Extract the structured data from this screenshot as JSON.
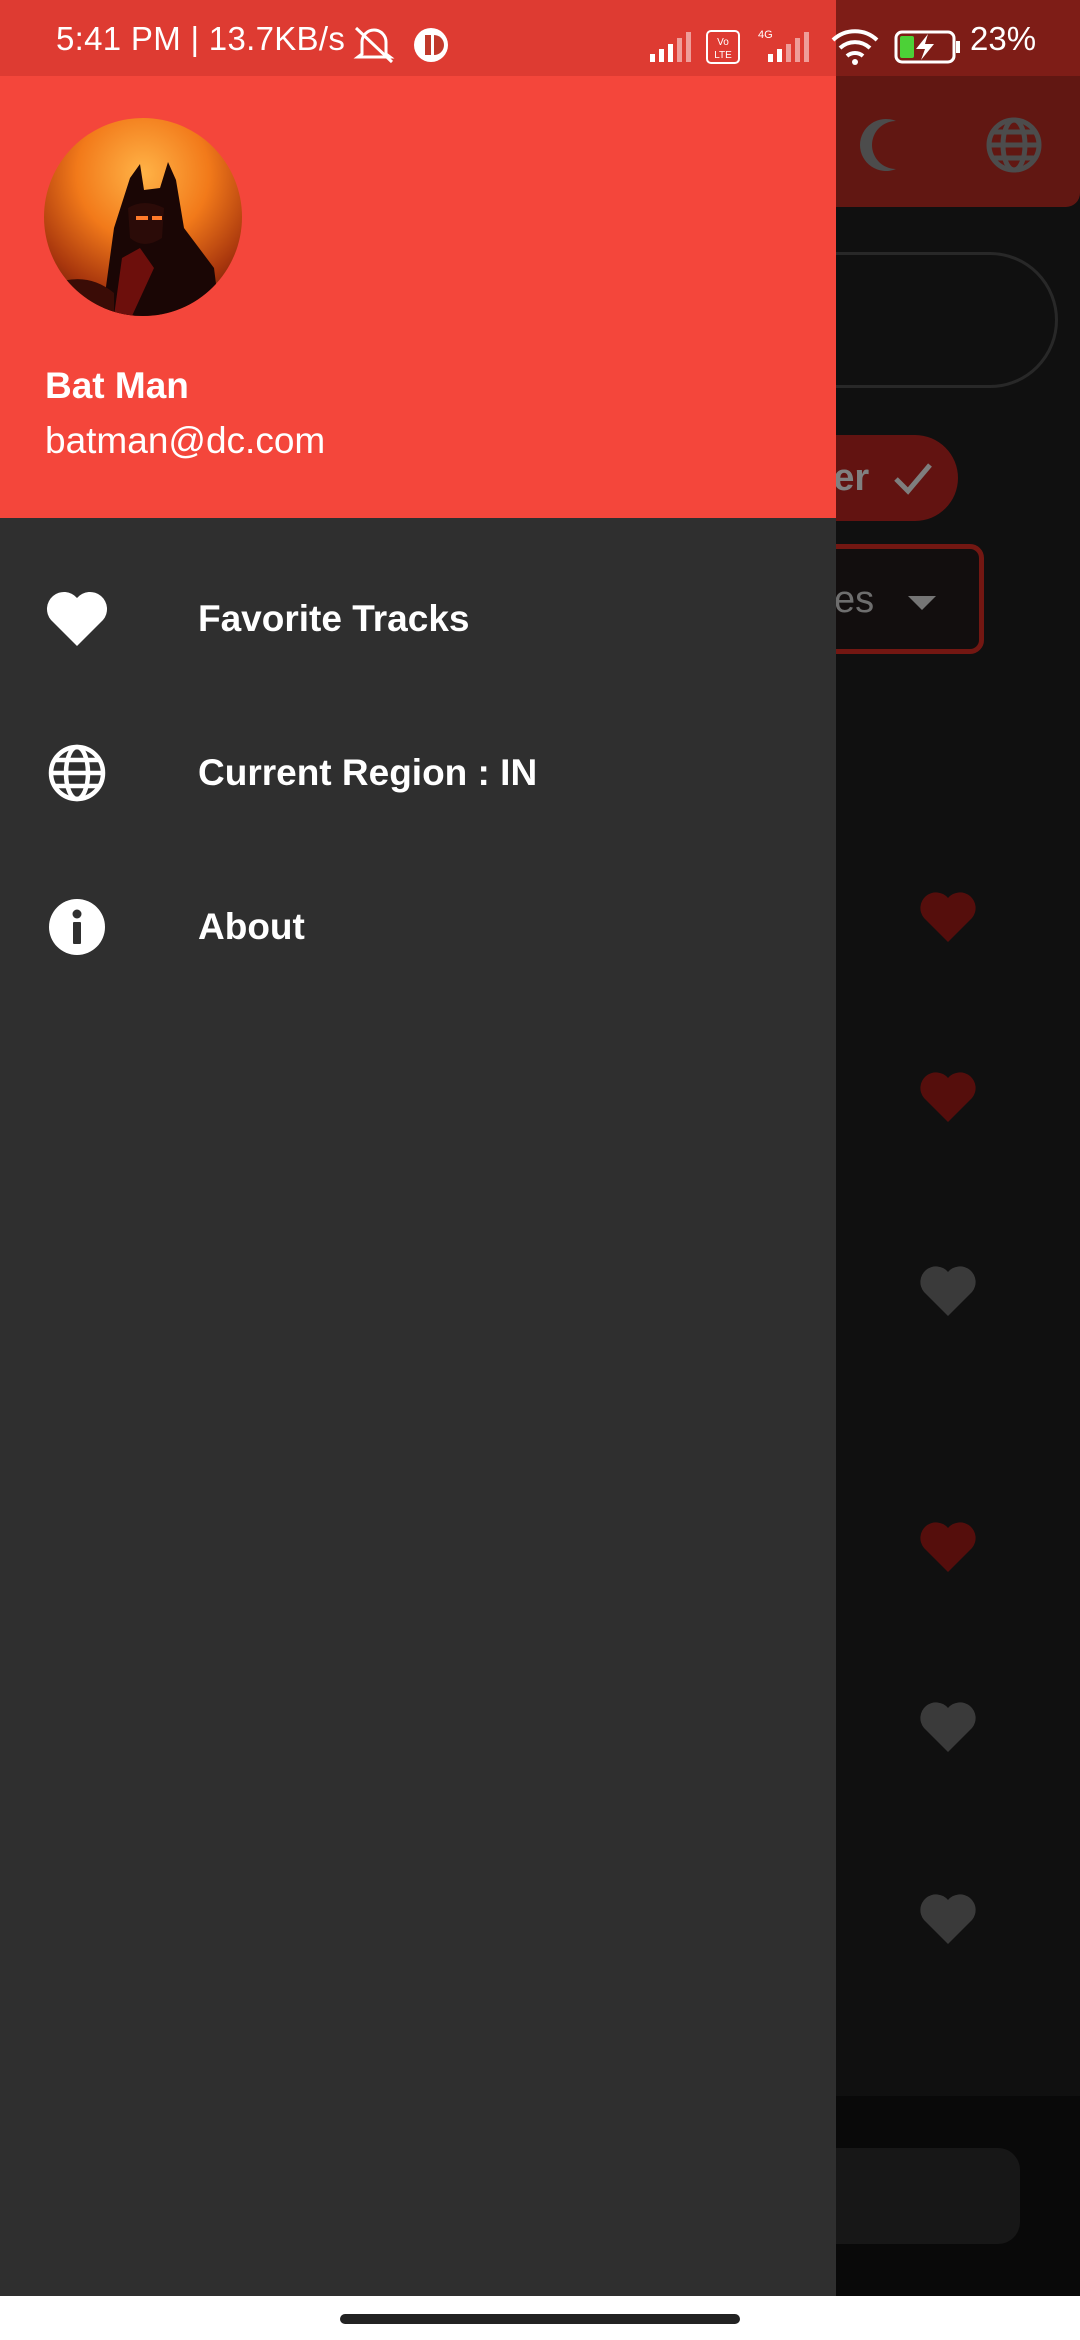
{
  "status_bar": {
    "time_text": "5:41 PM | 13.7KB/s",
    "battery_percent": "23%",
    "icons": [
      "mute-icon",
      "app-notification-icon",
      "signal-icon",
      "volte-icon",
      "signal-4g-icon",
      "wifi-icon",
      "battery-charging-icon"
    ],
    "volte_label": "Vo LTE",
    "network_label": "4G"
  },
  "drawer": {
    "header_color": "#f4463b",
    "user": {
      "name": "Bat Man",
      "email": "batman@dc.com"
    },
    "menu": [
      {
        "label": "Favorite Tracks",
        "icon": "heart-icon"
      },
      {
        "label": "Current Region : IN",
        "icon": "globe-icon"
      },
      {
        "label": "About",
        "icon": "info-icon"
      }
    ]
  },
  "background": {
    "topbar_icons": [
      "moon-icon",
      "globe-icon"
    ],
    "chip_label": "der",
    "dropdown_label": "ses",
    "hearts": [
      "red",
      "red",
      "grey",
      "red",
      "grey",
      "grey"
    ]
  }
}
